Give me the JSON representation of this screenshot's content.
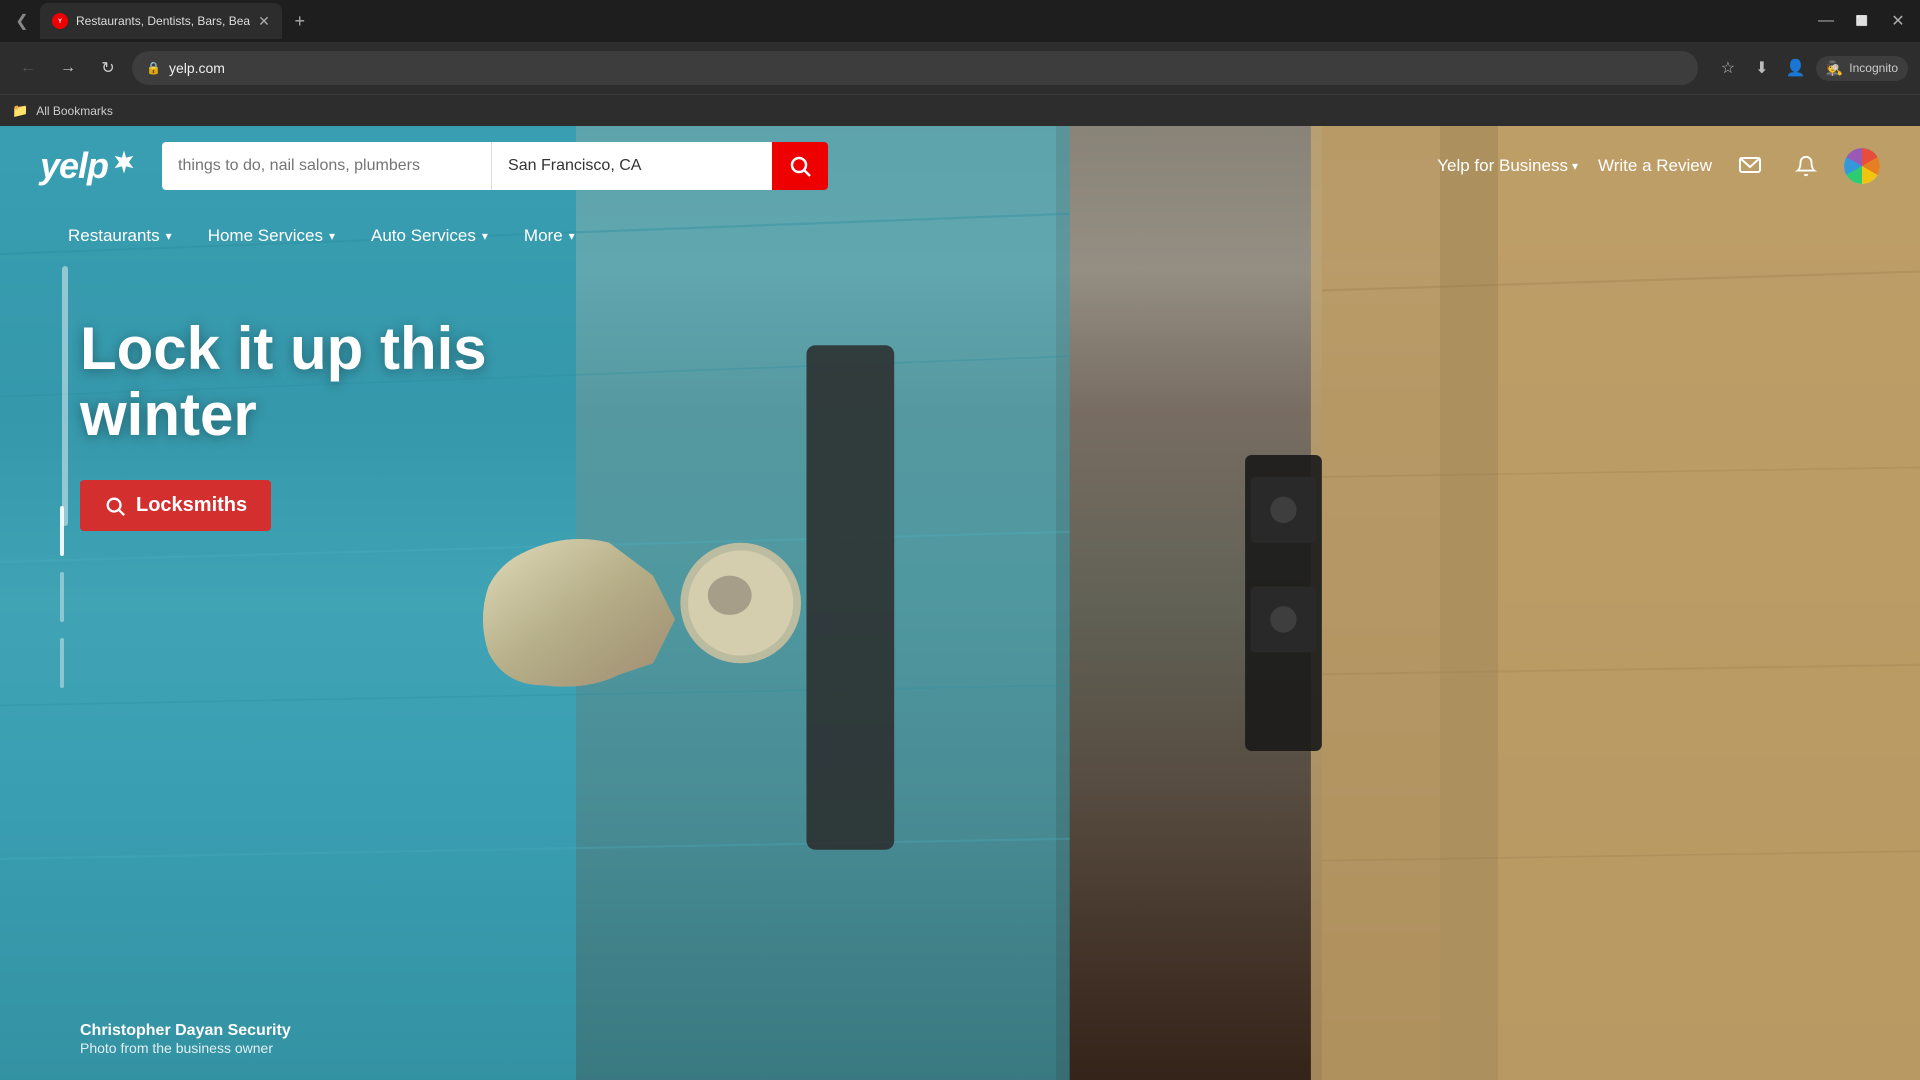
{
  "browser": {
    "tab": {
      "title": "Restaurants, Dentists, Bars, Bea",
      "favicon_label": "Y",
      "url": "yelp.com"
    },
    "nav": {
      "back_label": "←",
      "forward_label": "→",
      "reload_label": "↻",
      "incognito_label": "Incognito"
    },
    "bookmarks": {
      "label": "All Bookmarks"
    }
  },
  "yelp": {
    "logo_text": "yelp",
    "logo_burst": "✳",
    "search": {
      "find_placeholder": "things to do, nail salons, plumbers",
      "location_value": "San Francisco, CA",
      "button_label": "🔍"
    },
    "header": {
      "yelp_business_label": "Yelp for Business",
      "write_review_label": "Write a Review"
    },
    "nav": {
      "items": [
        {
          "label": "Restaurants",
          "has_chevron": true
        },
        {
          "label": "Home Services",
          "has_chevron": true
        },
        {
          "label": "Auto Services",
          "has_chevron": true
        },
        {
          "label": "More",
          "has_chevron": true
        }
      ]
    },
    "hero": {
      "title": "Lock it up this winter",
      "cta_label": "Locksmiths"
    },
    "photo_credit": {
      "name": "Christopher Dayan Security",
      "subtitle": "Photo from the business owner"
    }
  }
}
